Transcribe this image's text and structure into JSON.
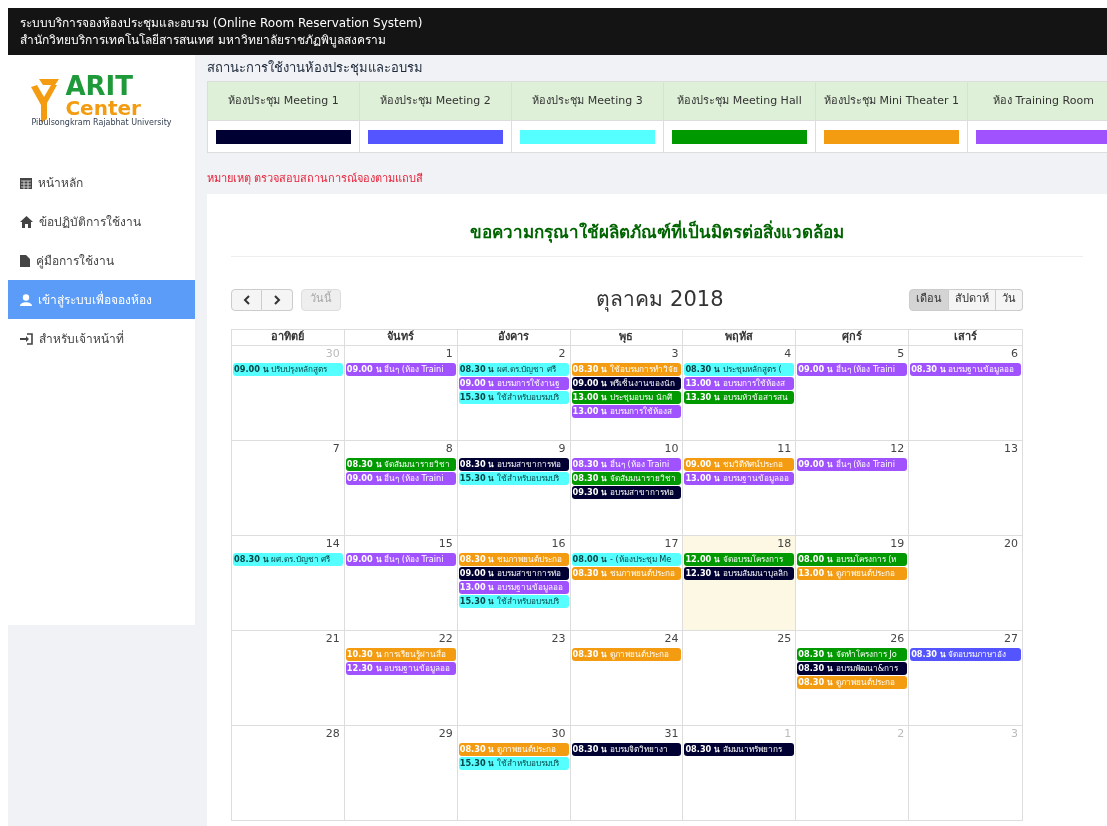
{
  "header": {
    "line_1": "ระบบบริการจองห้องประชุมและอบรม (Online Room Reservation System)",
    "line_2": "สำนักวิทยบริการเทคโนโลยีสารสนเทศ มหาวิทยาลัยราชภัฏพิบูลสงคราม"
  },
  "logo": {
    "line_1": "ARIT",
    "line_2": "Center",
    "tagline": "Pibulsongkram Rajabhat University"
  },
  "sidebar": {
    "items": [
      {
        "kind": "calendar",
        "label": "หน้าหลัก",
        "selected": false
      },
      {
        "kind": "home",
        "label": "ข้อปฏิบัติการใช้งาน",
        "selected": false
      },
      {
        "kind": "file",
        "label": "คู่มือการใช้งาน",
        "selected": false
      },
      {
        "kind": "user",
        "label": "เข้าสู่ระบบเพื่อจองห้อง",
        "selected": true
      },
      {
        "kind": "signin",
        "label": "สำหรับเจ้าหน้าที่",
        "selected": false
      }
    ]
  },
  "status": {
    "title": "สถานะการใช้งานห้องประชุมและอบรม",
    "rooms": [
      {
        "name": "ห้องประชุม Meeting 1",
        "color": "#000033"
      },
      {
        "name": "ห้องประชุม Meeting 2",
        "color": "#5555ff"
      },
      {
        "name": "ห้องประชุม Meeting 3",
        "color": "#55ffff"
      },
      {
        "name": "ห้องประชุม Meeting Hall",
        "color": "#009900"
      },
      {
        "name": "ห้องประชุม Mini Theater 1",
        "color": "#f39c12"
      },
      {
        "name": "ห้อง Training Room",
        "color": "#a052ff"
      }
    ],
    "note": "หมายเหตุ ตรวจสอบสถานการณ์จองตามแถบสี"
  },
  "banner": "ขอความกรุณาใช้ผลิตภัณฑ์ที่เป็นมิตรต่อสิ่งแวดล้อม",
  "calendar": {
    "title": "ตุลาคม 2018",
    "today_button": {
      "label": "วันนี้",
      "disabled": true
    },
    "views": [
      {
        "label": "เดือน",
        "selected": true
      },
      {
        "label": "สัปดาห์",
        "selected": false
      },
      {
        "label": "วัน",
        "selected": false
      }
    ],
    "weekdays": [
      "อาทิตย์",
      "จันทร์",
      "อังคาร",
      "พุธ",
      "พฤหัส",
      "ศุกร์",
      "เสาร์"
    ],
    "weeks": [
      {
        "days": [
          {
            "day": "30",
            "other_month": true,
            "today": false,
            "events": [
              {
                "text": "**09.00 น** ปรับปรุงหลักสูตร",
                "color": "#55ffff"
              }
            ]
          },
          {
            "day": "1",
            "other_month": false,
            "today": false,
            "events": [
              {
                "text": "**09.00 น** อื่นๆ (ห้อง Traini",
                "color": "#a052ff"
              }
            ]
          },
          {
            "day": "2",
            "other_month": false,
            "today": false,
            "events": [
              {
                "text": "**08.30 น** ผศ.ดร.บัญชา ศรี",
                "color": "#55ffff"
              },
              {
                "text": "**09.00 น** อบรมการใช้งานฐ",
                "color": "#a052ff"
              },
              {
                "text": "**15.30 น** ใช้สำหรับอบรมปริ",
                "color": "#55ffff"
              }
            ]
          },
          {
            "day": "3",
            "other_month": false,
            "today": false,
            "events": [
              {
                "text": "**08.30 น** ใช้อบรมการทำวิจัย",
                "color": "#f39c12"
              },
              {
                "text": "**09.00 น** พรีเซ็นงานของนัก",
                "color": "#000033"
              },
              {
                "text": "**13.00 น** ประชุมอบรม นักศึ",
                "color": "#009900"
              },
              {
                "text": "**13.00 น** อบรมการใช้ห้องส",
                "color": "#a052ff"
              }
            ]
          },
          {
            "day": "4",
            "other_month": false,
            "today": false,
            "events": [
              {
                "text": "**08.30 น** ประชุมหลักสูตร (",
                "color": "#55ffff"
              },
              {
                "text": "**13.00 น** อบรมการใช้ห้องส",
                "color": "#a052ff"
              },
              {
                "text": "**13.30 น** อบรมหัวข้อสารสน",
                "color": "#009900"
              }
            ]
          },
          {
            "day": "5",
            "other_month": false,
            "today": false,
            "events": [
              {
                "text": "**09.00 น** อื่นๆ (ห้อง Traini",
                "color": "#a052ff"
              }
            ]
          },
          {
            "day": "6",
            "other_month": false,
            "today": false,
            "events": [
              {
                "text": "**08.30 น** อบรมฐานข้อมูลออ",
                "color": "#a052ff"
              }
            ]
          }
        ]
      },
      {
        "days": [
          {
            "day": "7",
            "other_month": false,
            "today": false
          },
          {
            "day": "8",
            "other_month": false,
            "today": false,
            "events": [
              {
                "text": "**08.30 น** จัดสัมมนารายวิชา",
                "color": "#009900"
              },
              {
                "text": "**09.00 น** อื่นๆ (ห้อง Traini",
                "color": "#a052ff"
              }
            ]
          },
          {
            "day": "9",
            "other_month": false,
            "today": false,
            "events": [
              {
                "text": "**08.30 น** อบรมสาขาการท่อ",
                "color": "#000033"
              },
              {
                "text": "**15.30 น** ใช้สำหรับอบรมปริ",
                "color": "#55ffff"
              }
            ]
          },
          {
            "day": "10",
            "other_month": false,
            "today": false,
            "events": [
              {
                "text": "**08.30 น** อื่นๆ (ห้อง Traini",
                "color": "#a052ff"
              },
              {
                "text": "**08.30 น** จัดสัมมนารายวิชา",
                "color": "#009900"
              },
              {
                "text": "**09.30 น** อบรมสาขาการท่อ",
                "color": "#000033"
              }
            ]
          },
          {
            "day": "11",
            "other_month": false,
            "today": false,
            "events": [
              {
                "text": "**09.00 น** ชมวิดีทัศน์ประกอ",
                "color": "#f39c12"
              },
              {
                "text": "**13.00 น** อบรมฐานข้อมูลออ",
                "color": "#a052ff"
              }
            ]
          },
          {
            "day": "12",
            "other_month": false,
            "today": false,
            "events": [
              {
                "text": "**09.00 น** อื่นๆ (ห้อง Traini",
                "color": "#a052ff"
              }
            ]
          },
          {
            "day": "13",
            "other_month": false,
            "today": false
          }
        ]
      },
      {
        "days": [
          {
            "day": "14",
            "other_month": false,
            "today": false,
            "events": [
              {
                "text": "**08.30 น** ผศ.ดร.บัญชา ศรี",
                "color": "#55ffff"
              }
            ]
          },
          {
            "day": "15",
            "other_month": false,
            "today": false,
            "events": [
              {
                "text": "**09.00 น** อื่นๆ (ห้อง Traini",
                "color": "#a052ff"
              }
            ]
          },
          {
            "day": "16",
            "other_month": false,
            "today": false,
            "events": [
              {
                "text": "**08.30 น** ชมภาพยนต์ประกอ",
                "color": "#f39c12"
              },
              {
                "text": "**09.00 น** อบรมสาขาการท่อ",
                "color": "#000033"
              },
              {
                "text": "**13.00 น** อบรมฐานข้อมูลออ",
                "color": "#a052ff"
              },
              {
                "text": "**15.30 น** ใช้สำหรับอบรมปริ",
                "color": "#55ffff"
              }
            ]
          },
          {
            "day": "17",
            "other_month": false,
            "today": false,
            "events": [
              {
                "text": "**08.00 น** - (ห้องประชุม Me",
                "color": "#55ffff"
              },
              {
                "text": "**08.30 น** ชมภาพยนต์ประกอ",
                "color": "#f39c12"
              }
            ]
          },
          {
            "day": "18",
            "other_month": false,
            "today": true,
            "events": [
              {
                "text": "**12.00 น** จัดอบรมโครงการ",
                "color": "#009900"
              },
              {
                "text": "**12.30 น** อบรมสัมมนาบุลลิก",
                "color": "#000033"
              }
            ]
          },
          {
            "day": "19",
            "other_month": false,
            "today": false,
            "events": [
              {
                "text": "**08.00 น** อบรมโครงการ (ห",
                "color": "#009900"
              },
              {
                "text": "**13.00 น** ดูภาพยนต์ประกอ",
                "color": "#f39c12"
              }
            ]
          },
          {
            "day": "20",
            "other_month": false,
            "today": false
          }
        ]
      },
      {
        "days": [
          {
            "day": "21",
            "other_month": false,
            "today": false
          },
          {
            "day": "22",
            "other_month": false,
            "today": false,
            "events": [
              {
                "text": "**10.30 น** การเรียนรู้ผ่านสื่อ",
                "color": "#f39c12"
              },
              {
                "text": "**12.30 น** อบรมฐานข้อมูลออ",
                "color": "#a052ff"
              }
            ]
          },
          {
            "day": "23",
            "other_month": false,
            "today": false
          },
          {
            "day": "24",
            "other_month": false,
            "today": false,
            "events": [
              {
                "text": "**08.30 น** ดูภาพยนต์ประกอ",
                "color": "#f39c12"
              }
            ]
          },
          {
            "day": "25",
            "other_month": false,
            "today": false
          },
          {
            "day": "26",
            "other_month": false,
            "today": false,
            "events": [
              {
                "text": "**08.30 น** จัดทำโครงการ Jo",
                "color": "#009900"
              },
              {
                "text": "**08.30 น** อบรมพัฒนา&การ",
                "color": "#000033"
              },
              {
                "text": "**08.30 น** ดูภาพยนต์ประกอ",
                "color": "#f39c12"
              }
            ]
          },
          {
            "day": "27",
            "other_month": false,
            "today": false,
            "events": [
              {
                "text": "**08.30 น** จัดอบรมภาษาอัง",
                "color": "#5555ff"
              }
            ]
          }
        ]
      },
      {
        "days": [
          {
            "day": "28",
            "other_month": false,
            "today": false
          },
          {
            "day": "29",
            "other_month": false,
            "today": false
          },
          {
            "day": "30",
            "other_month": false,
            "today": false,
            "events": [
              {
                "text": "**08.30 น** ดูภาพยนต์ประกอ",
                "color": "#f39c12"
              },
              {
                "text": "**15.30 น** ใช้สำหรับอบรมปริ",
                "color": "#55ffff"
              }
            ]
          },
          {
            "day": "31",
            "other_month": false,
            "today": false,
            "events": [
              {
                "text": "**08.30 น** อบรมจิตวิทยางา",
                "color": "#000033"
              }
            ]
          },
          {
            "day": "1",
            "other_month": true,
            "today": false,
            "events": [
              {
                "text": "**08.30 น** สัมมนาทรัพยากร",
                "color": "#000033"
              }
            ]
          },
          {
            "day": "2",
            "other_month": true,
            "today": false
          },
          {
            "day": "3",
            "other_month": true,
            "today": false
          }
        ]
      }
    ]
  }
}
